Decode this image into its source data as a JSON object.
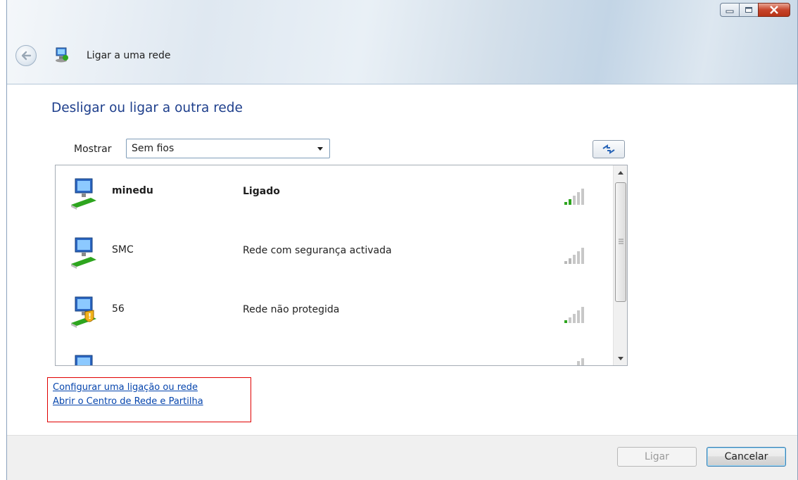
{
  "window": {
    "title": "Ligar a uma rede",
    "controls": [
      "minimize-icon",
      "maximize-icon",
      "close-icon"
    ]
  },
  "main": {
    "heading": "Desligar ou ligar a outra rede",
    "show_label": "Mostrar",
    "show_value": "Sem fios"
  },
  "networks": [
    {
      "name": "minedu",
      "status": "Ligado",
      "bold": true,
      "signal_bars": 2,
      "security": "none"
    },
    {
      "name": "SMC",
      "status": "Rede com segurança activada",
      "bold": false,
      "signal_bars": 1,
      "security": "secured"
    },
    {
      "name": "56",
      "status": "Rede não protegida",
      "bold": false,
      "signal_bars": 1,
      "security": "unsecured"
    },
    {
      "name": "",
      "status": "",
      "bold": false,
      "signal_bars": 0,
      "security": "none"
    }
  ],
  "links": {
    "setup": "Configurar uma ligação ou rede",
    "open_center": "Abrir o Centro de Rede e Partilha"
  },
  "footer": {
    "connect_label": "Ligar",
    "cancel_label": "Cancelar"
  },
  "colors": {
    "heading": "#1e3f8c",
    "link": "#0645ad",
    "highlight_box": "#e00000",
    "signal_active": "#2ea51f"
  }
}
